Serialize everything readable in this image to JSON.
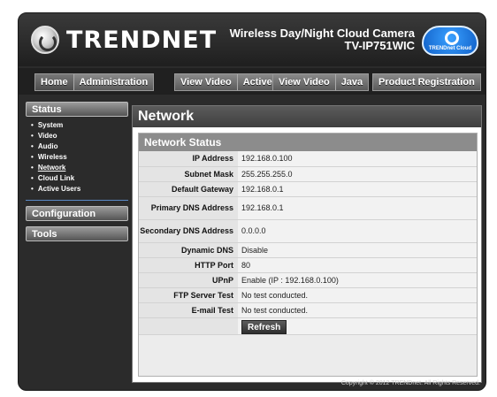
{
  "header": {
    "brand": "TRENDNET",
    "product_name": "Wireless Day/Night Cloud Camera",
    "model": "TV-IP751WIC",
    "cloud_badge": "TRENDnet Cloud"
  },
  "nav": {
    "home": "Home",
    "administration": "Administration",
    "view_video_activex_1": "View Video",
    "view_video_activex_2": "ActiveX",
    "view_video_java_1": "View Video",
    "view_video_java_2": "Java",
    "product_registration": "Product Registration"
  },
  "sidebar": {
    "status": "Status",
    "items": [
      {
        "label": "System"
      },
      {
        "label": "Video"
      },
      {
        "label": "Audio"
      },
      {
        "label": "Wireless"
      },
      {
        "label": "Network"
      },
      {
        "label": "Cloud Link"
      },
      {
        "label": "Active Users"
      }
    ],
    "configuration": "Configuration",
    "tools": "Tools"
  },
  "main": {
    "title": "Network",
    "panel_title": "Network Status",
    "rows": [
      {
        "label": "IP Address",
        "value": "192.168.0.100"
      },
      {
        "label": "Subnet Mask",
        "value": "255.255.255.0"
      },
      {
        "label": "Default Gateway",
        "value": "192.168.0.1"
      },
      {
        "label": "Primary DNS Address",
        "value": "192.168.0.1"
      },
      {
        "label": "Secondary DNS Address",
        "value": "0.0.0.0"
      },
      {
        "label": "Dynamic DNS",
        "value": "Disable"
      },
      {
        "label": "HTTP Port",
        "value": "80"
      },
      {
        "label": "UPnP",
        "value": "Enable (IP : 192.168.0.100)"
      },
      {
        "label": "FTP Server Test",
        "value": "No test conducted."
      },
      {
        "label": "E-mail Test",
        "value": "No test conducted."
      }
    ],
    "refresh_label": "Refresh"
  },
  "footer": {
    "copyright": "Copyright © 2012 TRENDnet.  All Rights Reserved."
  },
  "colors": {
    "frame": "#2b2b2b",
    "active_link_underline": "#5a8ac8",
    "panel_header": "#8c8c8c"
  }
}
